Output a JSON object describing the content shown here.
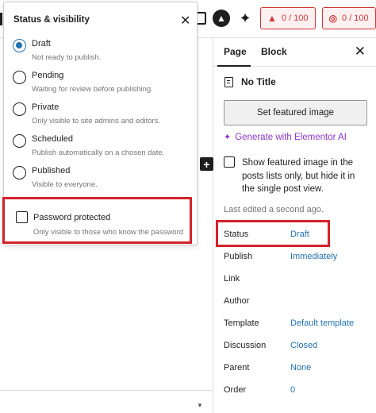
{
  "toolbar": {
    "score_badges": [
      {
        "icon": "seo-score-icon",
        "value": "0 / 100"
      },
      {
        "icon": "readability-score-icon",
        "value": "0 / 100"
      }
    ]
  },
  "popover": {
    "title": "Status & visibility",
    "options": [
      {
        "label": "Draft",
        "description": "Not ready to publish.",
        "selected": true
      },
      {
        "label": "Pending",
        "description": "Waiting for review before publishing.",
        "selected": false
      },
      {
        "label": "Private",
        "description": "Only visible to site admins and editors.",
        "selected": false
      },
      {
        "label": "Scheduled",
        "description": "Publish automatically on a chosen date.",
        "selected": false
      },
      {
        "label": "Published",
        "description": "Visible to everyone.",
        "selected": false
      }
    ],
    "password": {
      "label": "Password protected",
      "description": "Only visible to those who know the password",
      "checked": false
    }
  },
  "sidebar": {
    "tabs": [
      {
        "label": "Page",
        "active": true
      },
      {
        "label": "Block",
        "active": false
      }
    ],
    "doc_title": "No Title",
    "featured_button": "Set featured image",
    "elementor_link": "Generate with Elementor AI",
    "featured_checkbox_label": "Show featured image in the posts lists only, but hide it in the single post view.",
    "last_edited": "Last edited a second ago.",
    "properties": [
      {
        "key": "Status",
        "value": "Draft"
      },
      {
        "key": "Publish",
        "value": "Immediately"
      },
      {
        "key": "Link",
        "value": ""
      },
      {
        "key": "Author",
        "value": ""
      },
      {
        "key": "Template",
        "value": "Default template"
      },
      {
        "key": "Discussion",
        "value": "Closed"
      },
      {
        "key": "Parent",
        "value": "None"
      },
      {
        "key": "Order",
        "value": "0"
      }
    ]
  },
  "colors": {
    "accent": "#2271b1",
    "highlight": "#d2232a",
    "elementor": "#8c35c7",
    "score_alert": "#d63638"
  }
}
